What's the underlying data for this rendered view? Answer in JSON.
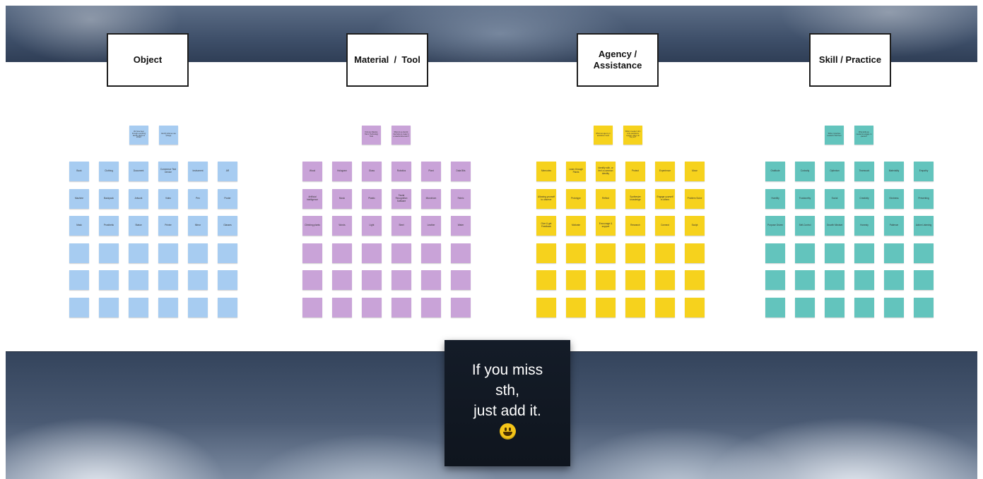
{
  "headers": [
    {
      "label": "Object"
    },
    {
      "label": "Material  /  Tool"
    },
    {
      "label": "Agency /\nAssistance"
    },
    {
      "label": "Skill / Practice"
    }
  ],
  "colors": {
    "object": "#a7ccf1",
    "material": "#c9a3d8",
    "agency": "#f6d21d",
    "skill": "#63c4bd",
    "callout": "#141c28"
  },
  "columns": [
    {
      "id": "object",
      "hints": [
        "We have been through everything Identify Object or artifact",
        "Identify what we use (things)"
      ],
      "notes": [
        "Book",
        "Clothing",
        "Document",
        "Commerce Test Device",
        "Instrument",
        "AR",
        "Machine",
        "Backpack",
        "Artwork",
        "Video",
        "Pen",
        "Poster",
        "Mask",
        "Prosthetic",
        "Statue",
        "Printer",
        "Mirror",
        "Glasses",
        "",
        "",
        "",
        "",
        "",
        "",
        "",
        "",
        "",
        "",
        "",
        "",
        "",
        "",
        "",
        "",
        "",
        ""
      ]
    },
    {
      "id": "material",
      "hints": [
        "Find any Material, Tool or Technology Tools",
        "What do we identify that helps to create in a material dimension?"
      ],
      "notes": [
        "Wood",
        "Hologram",
        "Glass",
        "Robotics",
        "Plant",
        "Data Bits",
        "Artificial Intelligence",
        "Music",
        "Plastic",
        "Facial Recognition Software",
        "Microbiom",
        "Fabric",
        "Climbing plants",
        "Words",
        "Light",
        "Steel",
        "Leather",
        "Water",
        "",
        "",
        "",
        "",
        "",
        "",
        "",
        "",
        "",
        "",
        "",
        "",
        "",
        "",
        "",
        "",
        "",
        ""
      ]
    },
    {
      "id": "agency",
      "hints": [
        "What can agency or assistance mean",
        "What is needed, who is the assistance support, where do they act?"
      ],
      "notes": [
        "Memories",
        "Learn through Plants",
        "Identify with, or feel a common identity",
        "Protect",
        "Experience",
        "Move",
        "Allowing yourself to observe",
        "Prototype",
        "Reflect",
        "Synthesize knowledge",
        "Engage yourself in others",
        "Problem Solve",
        "Give & get Feedback",
        "Motivate",
        "Encourage & support",
        "Research",
        "Connect",
        "Sculpt",
        "",
        "",
        "",
        "",
        "",
        "",
        "",
        "",
        "",
        "",
        "",
        "",
        "",
        "",
        "",
        "",
        "",
        ""
      ]
    },
    {
      "id": "skill",
      "hints": [
        "Skills or practices needed to find them",
        "What skills are needed to engage, to practice?"
      ],
      "notes": [
        "Gratitude",
        "Curiosity",
        "Optimism",
        "Teamwork",
        "Materiality",
        "Empathy",
        "Humility",
        "Trustworthy",
        "Social",
        "Creativity",
        "Kindness",
        "Presenting",
        "Purpose Driven",
        "Self-Control",
        "Growth Mindset",
        "Honesty",
        "Patience",
        "Active Listening",
        "",
        "",
        "",
        "",
        "",
        "",
        "",
        "",
        "",
        "",
        "",
        "",
        "",
        "",
        "",
        "",
        "",
        ""
      ]
    }
  ],
  "callout": {
    "line1": "If you miss",
    "line2": "sth,",
    "line3": "just add it."
  }
}
